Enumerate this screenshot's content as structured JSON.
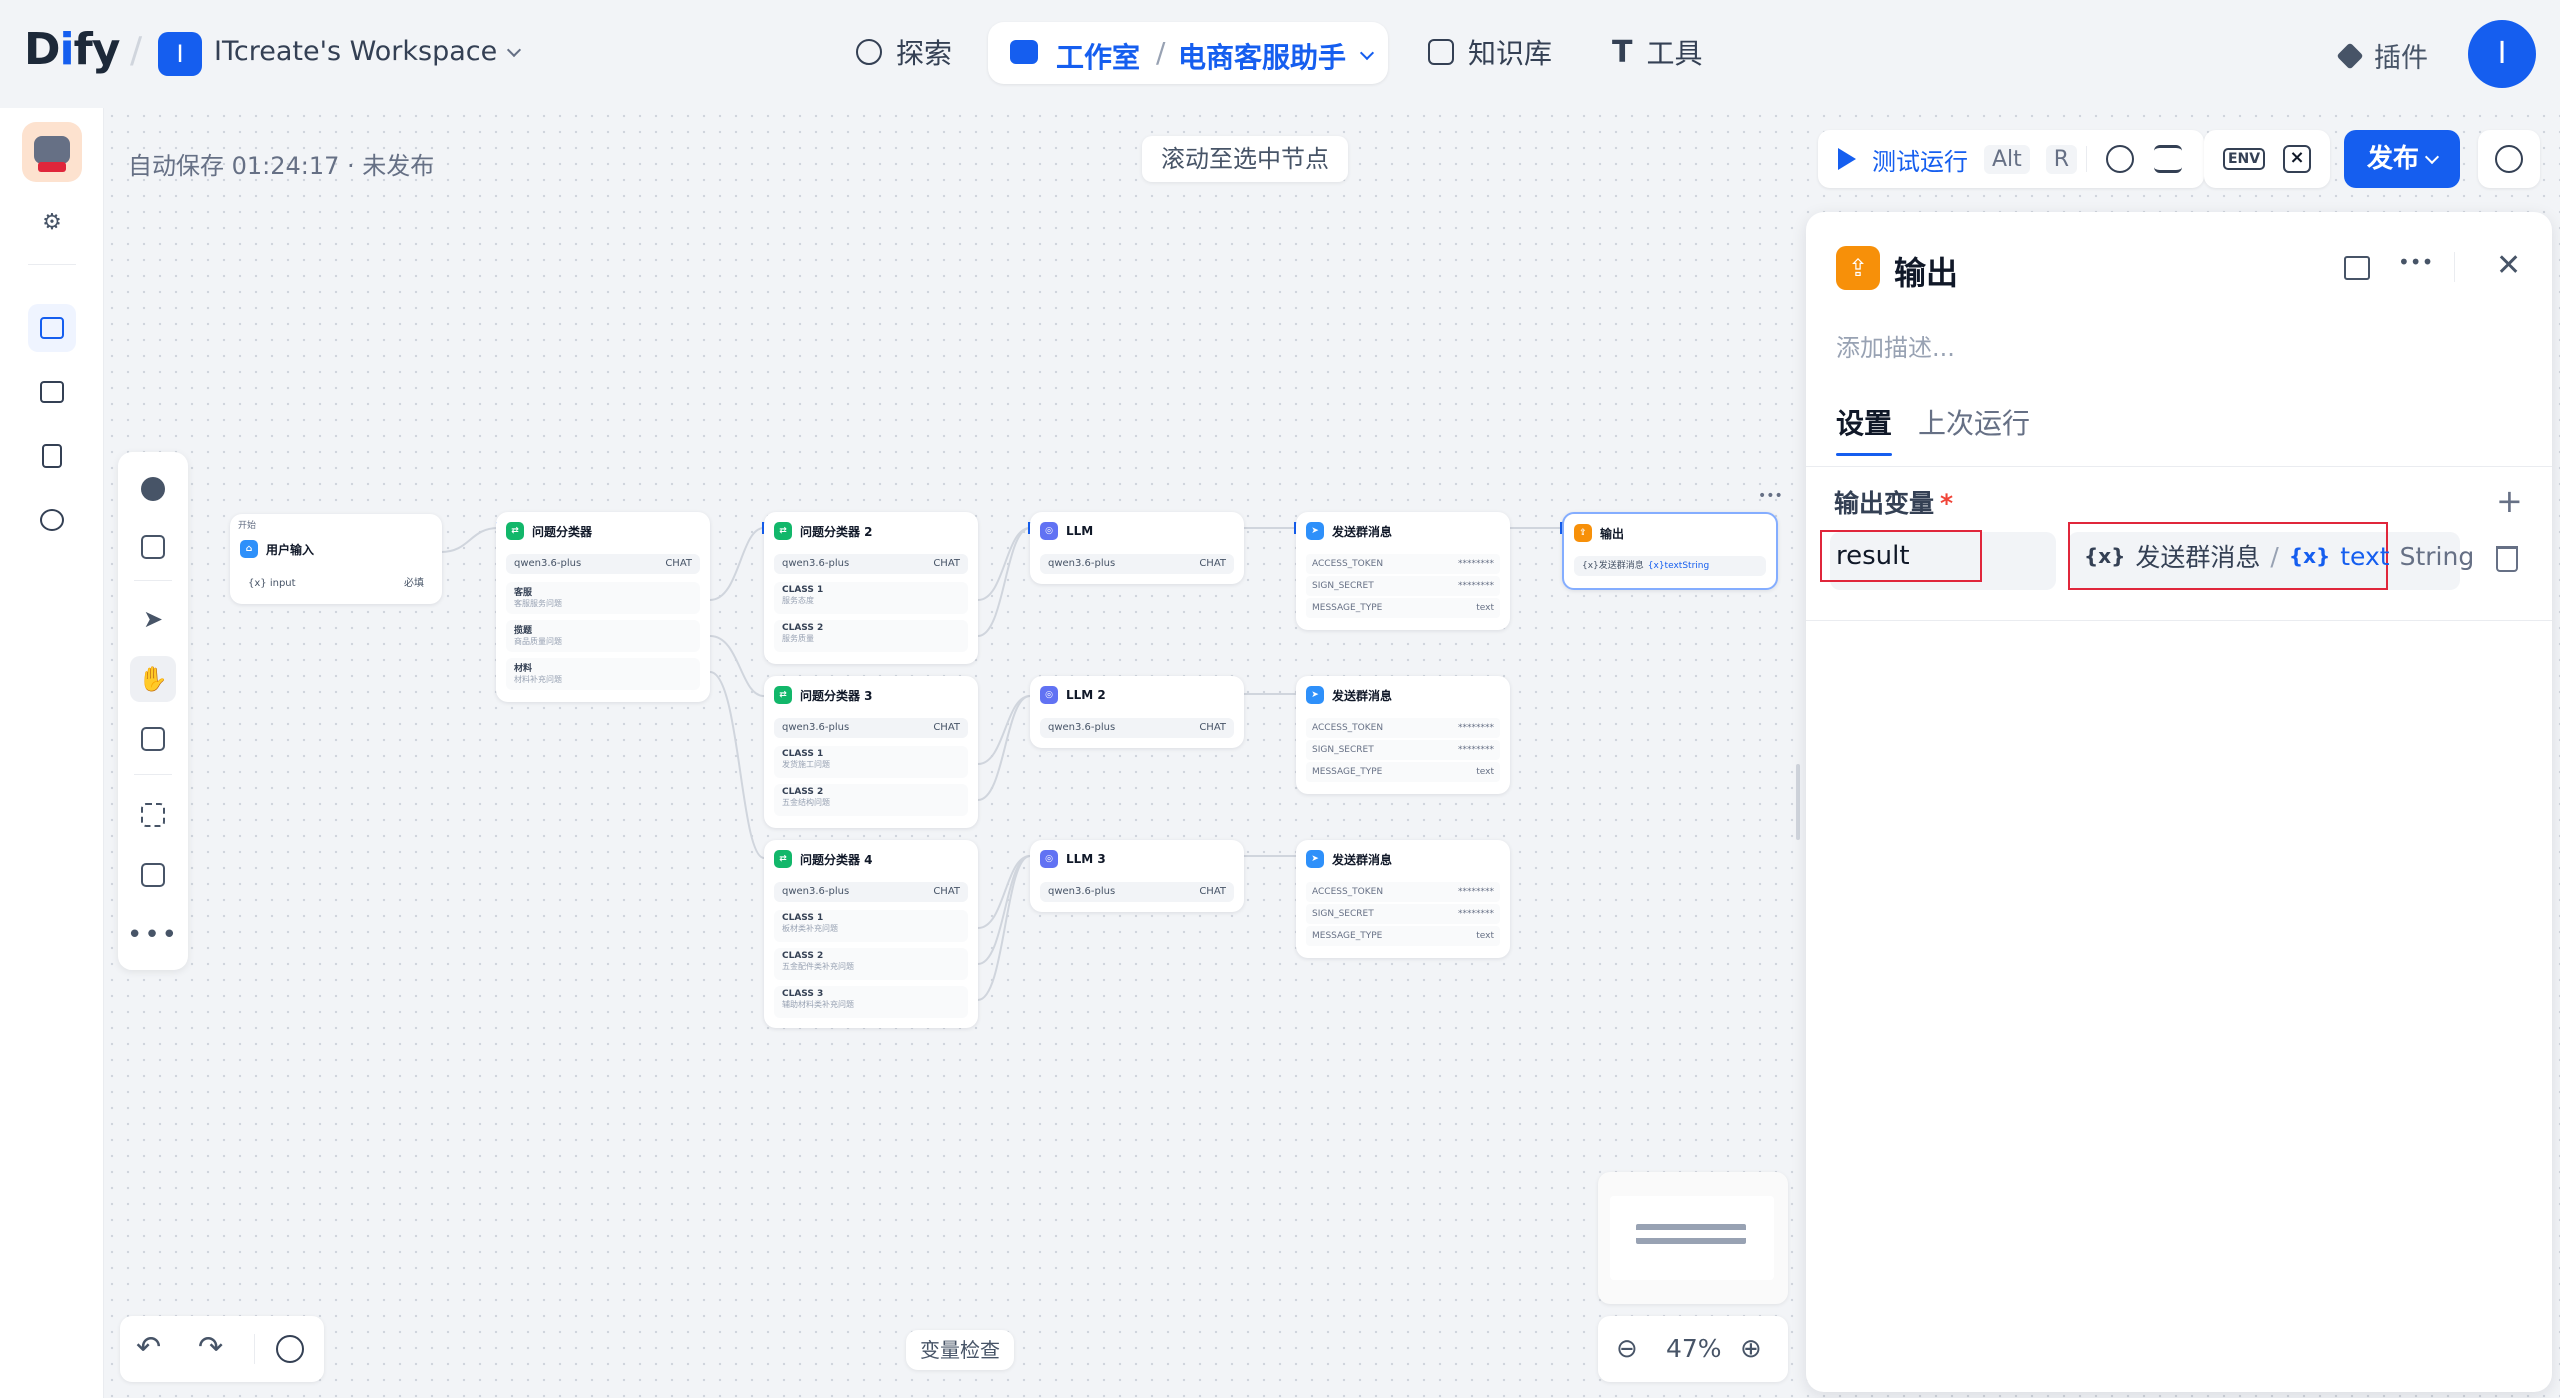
{
  "app": {
    "logo_text_a": "D",
    "logo_text_i": "i",
    "logo_text_b": "fy"
  },
  "workspace": {
    "badge": "I",
    "name": "ITcreate's Workspace"
  },
  "nav": {
    "explore": "探索",
    "studio": "工作室",
    "app_name": "电商客服助手",
    "knowledge": "知识库",
    "tools": "工具",
    "plugins": "插件"
  },
  "user": {
    "avatar": "I"
  },
  "canvas": {
    "autosave": "自动保存 01:24:17 · 未发布",
    "scroll_to_selected": "滚动至选中节点",
    "var_inspect": "变量检查",
    "zoom": "47%"
  },
  "toolbar": {
    "test_run": "测试运行",
    "key1": "Alt",
    "key2": "R",
    "env": "ENV",
    "publish": "发布"
  },
  "nodes": {
    "start_tag": "开始",
    "start": {
      "title": "用户输入",
      "var": "input",
      "var_meta": "必填"
    },
    "classifier1": {
      "title": "问题分类器",
      "model": "qwen3.6-plus",
      "mode": "CHAT",
      "classes": [
        {
          "name": "客服",
          "desc": "客服服务问题"
        },
        {
          "name": "揽题",
          "desc": "商品质量问题"
        },
        {
          "name": "材料",
          "desc": "材料补充问题"
        }
      ]
    },
    "classifier2": {
      "title": "问题分类器 2",
      "model": "qwen3.6-plus",
      "mode": "CHAT",
      "classes": [
        {
          "name": "CLASS 1",
          "desc": "服务态度"
        },
        {
          "name": "CLASS 2",
          "desc": "服务质量"
        }
      ]
    },
    "classifier3": {
      "title": "问题分类器 3",
      "model": "qwen3.6-plus",
      "mode": "CHAT",
      "classes": [
        {
          "name": "CLASS 1",
          "desc": "发货施工问题"
        },
        {
          "name": "CLASS 2",
          "desc": "五金结构问题"
        }
      ]
    },
    "classifier4": {
      "title": "问题分类器 4",
      "model": "qwen3.6-plus",
      "mode": "CHAT",
      "classes": [
        {
          "name": "CLASS 1",
          "desc": "板材类补充问题"
        },
        {
          "name": "CLASS 2",
          "desc": "五金配件类补充问题"
        },
        {
          "name": "CLASS 3",
          "desc": "辅助材料类补充问题"
        }
      ]
    },
    "llm1": {
      "title": "LLM",
      "model": "qwen3.6-plus",
      "mode": "CHAT"
    },
    "llm2": {
      "title": "LLM 2",
      "model": "qwen3.6-plus",
      "mode": "CHAT"
    },
    "llm3": {
      "title": "LLM 3",
      "model": "qwen3.6-plus",
      "mode": "CHAT"
    },
    "send": {
      "title": "发送群消息",
      "k1": "ACCESS_TOKEN",
      "k2": "SIGN_SECRET",
      "k3": "MESSAGE_TYPE",
      "mask": "********",
      "type": "text"
    },
    "output": {
      "title": "输出",
      "ref": "{x}发送群消息",
      "ref_var": "{x}textString"
    }
  },
  "panel": {
    "title": "输出",
    "desc_placeholder": "添加描述...",
    "tabs": [
      "设置",
      "上次运行"
    ],
    "output_vars_label": "输出变量",
    "required_mark": "*",
    "var_name": "result",
    "var_source_node": "发送群消息",
    "var_sep": "/",
    "var_field": "text",
    "var_type": "String",
    "var_prefix": "{x}"
  },
  "colors": {
    "accent": "#155eef",
    "output_icon": "#f79009",
    "classifier_icon": "#12b76a",
    "llm_icon": "#6172f3",
    "send_icon": "#2e90fa",
    "highlight": "#e0263b"
  }
}
